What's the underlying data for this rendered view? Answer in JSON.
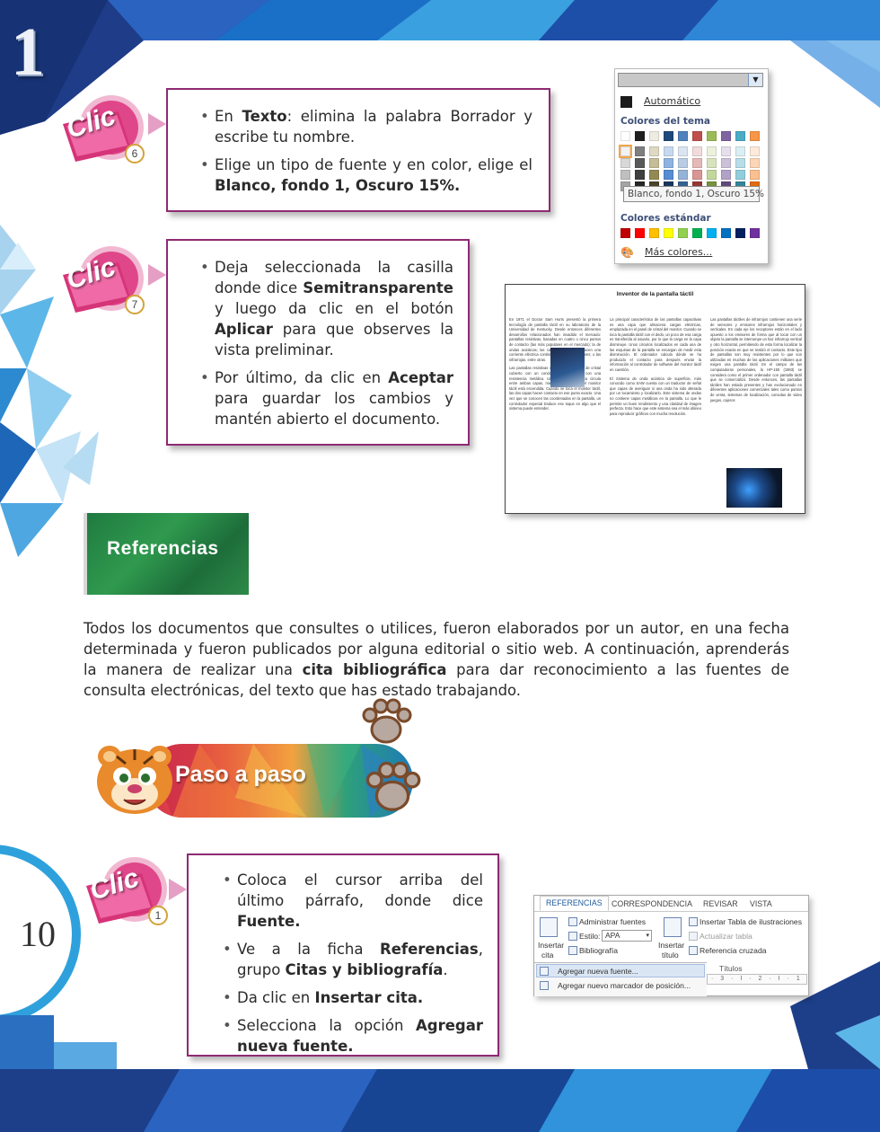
{
  "page": {
    "chapter_number": "1",
    "page_number": "10"
  },
  "steps": [
    {
      "badge": {
        "label": "Clic",
        "number": "6"
      },
      "bullets": [
        [
          {
            "t": "En "
          },
          {
            "t": "Texto",
            "b": true
          },
          {
            "t": ": elimina la palabra Borrador y escribe tu nombre."
          }
        ],
        [
          {
            "t": "Elige un tipo de fuente y en color, elige el "
          },
          {
            "t": "Blanco, fondo 1, Oscuro 15%.",
            "b": true
          }
        ]
      ]
    },
    {
      "badge": {
        "label": "Clic",
        "number": "7"
      },
      "bullets": [
        [
          {
            "t": "Deja seleccionada la casilla donde dice "
          },
          {
            "t": "Semitransparente",
            "b": true
          },
          {
            "t": " y luego da clic en el botón "
          },
          {
            "t": "Aplicar",
            "b": true
          },
          {
            "t": " para que observes la vista preliminar."
          }
        ],
        [
          {
            "t": "Por último, da clic en "
          },
          {
            "t": "Aceptar",
            "b": true
          },
          {
            "t": " para guardar los cambios y mantén abierto el documento."
          }
        ]
      ]
    },
    {
      "badge": {
        "label": "Clic",
        "number": "1"
      },
      "bullets": [
        [
          {
            "t": "Coloca el cursor arriba del último párrafo, donde dice "
          },
          {
            "t": "Fuente.",
            "b": true
          }
        ],
        [
          {
            "t": "Ve a la ficha "
          },
          {
            "t": "Referencias",
            "b": true
          },
          {
            "t": ", grupo "
          },
          {
            "t": "Citas y bibliografía",
            "b": true
          },
          {
            "t": "."
          }
        ],
        [
          {
            "t": "Da clic en "
          },
          {
            "t": "Insertar cita.",
            "b": true
          }
        ],
        [
          {
            "t": "Selecciona la opción "
          },
          {
            "t": "Agregar nueva fuente.",
            "b": true
          }
        ]
      ]
    }
  ],
  "color_picker": {
    "automatic_label": "Automático",
    "theme_colors_label": "Colores del tema",
    "tooltip": "Blanco, fondo 1, Oscuro 15%",
    "standard_colors_label": "Colores estándar",
    "more_colors_label": "Más colores...",
    "theme_top_row": [
      "#ffffff",
      "#1f1f1f",
      "#eeece1",
      "#1f497d",
      "#4f81bd",
      "#c0504d",
      "#9bbb59",
      "#8064a2",
      "#4bacc6",
      "#f79646"
    ],
    "theme_shades": [
      [
        "#f2f2f2",
        "#7f7f7f",
        "#ddd9c3",
        "#c6d9f0",
        "#dbe5f1",
        "#f2dcdb",
        "#ebf1dd",
        "#e5e0ec",
        "#dbeef3",
        "#fdeada"
      ],
      [
        "#d8d8d8",
        "#595959",
        "#c4bd97",
        "#8db3e2",
        "#b8cce4",
        "#e5b9b7",
        "#d7e3bc",
        "#ccc1d9",
        "#b7dde8",
        "#fbd5b5"
      ],
      [
        "#bfbfbf",
        "#3f3f3f",
        "#938953",
        "#548dd4",
        "#95b3d7",
        "#d99694",
        "#c3d69b",
        "#b2a2c7",
        "#92cddc",
        "#fac08f"
      ],
      [
        "#a5a5a5",
        "#262626",
        "#494429",
        "#17365d",
        "#366092",
        "#953734",
        "#76923c",
        "#5f497a",
        "#31859b",
        "#e36c09"
      ]
    ],
    "standard_colors": [
      "#c00000",
      "#ff0000",
      "#ffc000",
      "#ffff00",
      "#92d050",
      "#00b050",
      "#00b0f0",
      "#0070c0",
      "#002060",
      "#7030a0"
    ]
  },
  "doc_preview": {
    "title": "Inventor de la pantalla táctil",
    "col1": [
      "En 1971 el Doctor Sam Hurts presentó la primera tecnología de pantalla táctil en su laboratorio de la Universidad de Kentucky. Desde entonces diferentes desarrollos relacionados han invadido el mercado: pantallas resistivas, basadas en cuatro o cinco puntos de contacto (las más populares en el mercado); la de ondas acústicas; las capacitivas, que conducen una corriente eléctrica continua a través de sensores; o las infrarrojas, entre otras.",
      "Las pantallas resistivas constan de un panel de cristal cubierto con un conductor y una capa con una resistencia metálica. Una corriente eléctrica circula entre ambas capas, mientras la pantalla del monitor táctil está encendida. Cuando se toca el monitor táctil, las dos capas hacen contacto en ese punto exacto. Una vez que se conocen las coordenadas en la pantalla, un controlador especial traduce ese toque en algo que el sistema puede entender."
    ],
    "col2": [
      "La principal característica de las pantallas capacitivas es una capa que almacena cargas eléctricas, emplazada en el panel de cristal del monitor. Cuando se toca la pantalla táctil con el dedo, un poco de esa carga es transferida al usuario, por lo que la carga en la capa disminuye. Unos circuitos localizados en cada una de las esquinas de la pantalla se encargan de medir esta disminución. El ordenador calcula dónde se ha producido el contacto para después enviar la información al controlador de software del monitor táctil en cuestión.",
      "El Sistema de onda acústica de superficie, más conocido como SAW cuenta con un traductor de señal que capas de averiguar si una onda ha sido alterada por un tocamiento y localizarlo. Este sistema de ondas no contiene capas metálicas en la pantalla. Lo que le permite un buen rendimiento y una claridad de imagen perfecta. Esto hace que este sistema sea el más idóneo para reproducir gráficos con mucha resolución."
    ],
    "col3": [
      "Las pantallas táctiles de infrarrojos contienen una serie de sensores y emisores infrarrojos horizontales y verticales. En cada eje los receptores están en el lado opuesto a los emisores de forma que al tocar con un objeto la pantalla se interrumpe un haz infrarrojo vertical y otro horizontal, permitiendo de esta forma localizar la posición exacta en que se realizó el contacto. Este tipo de pantallas son muy resistentes por lo que son utilizadas en muchas de las aplicaciones militares que exigen una pantalla táctil. En el campo de las computadoras personales, la HP-150 (1983) se considera como el primer ordenador con pantalla táctil que se comercializó. Desde entonces, las pantallas táctiles han estado presentes y han evolucionado en diferentes aplicaciones comerciales tales como puntos de venta, sistemas de localización, consolas de video juegos, cajeros"
    ]
  },
  "references": {
    "title": "Referencias",
    "intro": [
      {
        "t": "Todos los documentos que consultes o utilices, fueron elaborados por un autor, en una fecha determinada y fueron publicados por alguna editorial o sitio web. A continuación, aprenderás la manera de realizar una "
      },
      {
        "t": "cita bibliográfica",
        "b": true
      },
      {
        "t": " para dar reconocimiento a las fuentes de consulta electrónicas, del texto que has estado trabajando."
      }
    ]
  },
  "paso": {
    "title": "Paso a paso"
  },
  "ribbon": {
    "tabs": [
      "REFERENCIAS",
      "CORRESPONDENCIA",
      "REVISAR",
      "VISTA"
    ],
    "manage_sources": "Administrar fuentes",
    "style_label": "Estilo:",
    "style_value": "APA",
    "bibliography": "Bibliografía",
    "insert_cite_line1": "Insertar",
    "insert_cite_line2": "cita",
    "insert_caption_line1": "Insertar",
    "insert_caption_line2": "título",
    "insert_table_figures": "Insertar Tabla de ilustraciones",
    "update_table": "Actualizar tabla",
    "cross_reference": "Referencia cruzada",
    "group_titles": "Títulos",
    "menu_add_source": "Agregar nueva fuente...",
    "menu_add_placeholder": "Agregar nuevo marcador de posición...",
    "ruler": "· 3 · I · 2 · I · 1"
  },
  "colors": {
    "box_border": "#8e2a72",
    "arrow": "#e59fc4",
    "badge_pink": "#e0468a",
    "green": "#2f9a4e",
    "blue_dark": "#1d3f8a",
    "blue_light": "#38a8e0"
  }
}
